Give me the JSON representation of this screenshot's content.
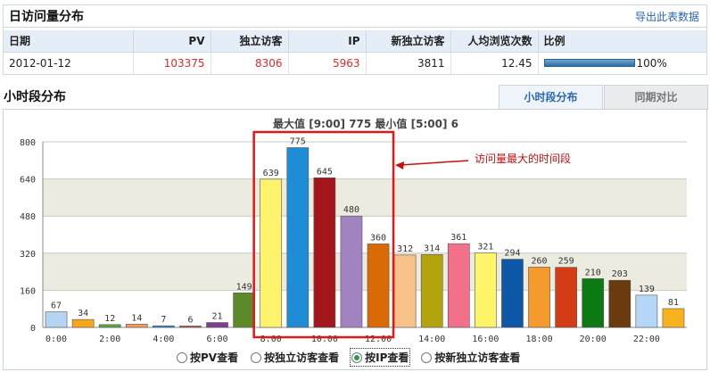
{
  "daily": {
    "title": "日访问量分布",
    "export_label": "导出此表数据",
    "columns": [
      "日期",
      "PV",
      "独立访客",
      "IP",
      "新独立访客",
      "人均浏览次数",
      "比例"
    ],
    "row": {
      "date": "2012-01-12",
      "pv": "103375",
      "uv": "8306",
      "ip": "5963",
      "new_uv": "3811",
      "avg_views": "12.45",
      "ratio": "100%"
    }
  },
  "hourly": {
    "title": "小时段分布",
    "tabs": [
      {
        "label": "小时段分布",
        "active": true
      },
      {
        "label": "同期对比",
        "active": false
      }
    ],
    "radios": [
      {
        "label": "按PV查看",
        "checked": false
      },
      {
        "label": "按独立访客查看",
        "checked": false
      },
      {
        "label": "按IP查看",
        "checked": true
      },
      {
        "label": "按新独立访客查看",
        "checked": false
      }
    ]
  },
  "chart_data": {
    "type": "bar",
    "title": "最大值 [9:00] 775  最小值 [5:00] 6",
    "categories": [
      "0:00",
      "1:00",
      "2:00",
      "3:00",
      "4:00",
      "5:00",
      "6:00",
      "7:00",
      "8:00",
      "9:00",
      "10:00",
      "11:00",
      "12:00",
      "13:00",
      "14:00",
      "15:00",
      "16:00",
      "17:00",
      "18:00",
      "19:00",
      "20:00",
      "21:00",
      "22:00",
      "23:00"
    ],
    "values": [
      67,
      34,
      12,
      14,
      7,
      6,
      21,
      149,
      639,
      775,
      645,
      480,
      360,
      312,
      314,
      361,
      321,
      294,
      260,
      259,
      210,
      203,
      139,
      81
    ],
    "value_labels": [
      "67",
      "34",
      "12",
      "14",
      "7",
      "6",
      "21",
      "149",
      "639",
      "775",
      "645",
      "480",
      "360",
      "312",
      "314",
      "361",
      "321",
      "294",
      "260",
      "259",
      "210",
      "203",
      "139",
      "81"
    ],
    "colors": [
      "#b4d4f2",
      "#f7a61a",
      "#5aa63a",
      "#f89a5a",
      "#2a8fd1",
      "#c0504d",
      "#7e3f8e",
      "#5c8a2b",
      "#fff36b",
      "#1f8dd6",
      "#a3161c",
      "#a183c2",
      "#d96a05",
      "#f9c18a",
      "#b3a40e",
      "#f2708a",
      "#fff46a",
      "#0e58a8",
      "#f59a2c",
      "#d43c16",
      "#0b7a12",
      "#6b3a0e",
      "#b5d6f6",
      "#f7b21d"
    ],
    "ylim": [
      0,
      800
    ],
    "yticks": [
      "0",
      "160",
      "320",
      "480",
      "640",
      "800"
    ],
    "xticks": [
      "0:00",
      "2:00",
      "4:00",
      "6:00",
      "8:00",
      "10:00",
      "12:00",
      "14:00",
      "16:00",
      "18:00",
      "20:00",
      "22:00"
    ],
    "annotation": "访问量最大的时间段"
  }
}
